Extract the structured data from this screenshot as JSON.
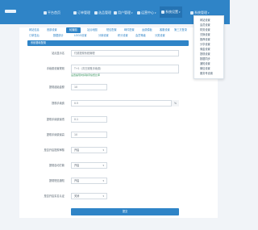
{
  "nav": {
    "items": [
      {
        "label": "平台首页"
      },
      {
        "label": "订单管理"
      },
      {
        "label": "选品管理"
      },
      {
        "label": "用户管理"
      },
      {
        "label": "运营中心"
      },
      {
        "label": "系统设置"
      },
      {
        "label": "系统管理"
      }
    ]
  },
  "dropdown": {
    "items": [
      "网站设置",
      "会员设置",
      "财务设置",
      "兑换设置",
      "推荐设置",
      "分享设置",
      "佣金设置",
      "提现设置",
      "数据同步",
      "通知设置",
      "微信设置",
      "服务号设置"
    ]
  },
  "tabs": {
    "row1": [
      "网站信息",
      "底部设置",
      "轮播图",
      "站点地图",
      "短信配置",
      "邮件配置",
      "运费模板",
      "客服设置",
      "第三方登录",
      "帮助中心"
    ],
    "row2": [
      "订单售后",
      "数据统计",
      "LOGO设置",
      "分销设置",
      "积分设置",
      "会员等级",
      "分类设置"
    ]
  },
  "section": {
    "title": "系统基础配置"
  },
  "form": {
    "site_name": {
      "label": "站点显示名",
      "value": "付费提现系统管理"
    },
    "fee_rate": {
      "label": "手续费设置规则",
      "value": "T+1（次日到账手续费）",
      "hint": "设置提现时扣除手续费比率"
    },
    "min_amount": {
      "label": "提现起始金额",
      "value": "10"
    },
    "rate": {
      "label": "提现手续费",
      "value": "0.5",
      "suffix": "%"
    },
    "min_fee": {
      "label": "提现手续费最低",
      "value": "0.1"
    },
    "max_fee": {
      "label": "提现手续费最高",
      "value": "10"
    },
    "switch1": {
      "label": "是否开启提现审核",
      "value": "开启"
    },
    "switch2": {
      "label": "提现自动打款",
      "value": "开启"
    },
    "switch3": {
      "label": "提现短信通知",
      "value": "开启"
    },
    "switch4": {
      "label": "是否开启实名认证",
      "value": "关闭"
    },
    "switch5": {
      "label": "银行卡信息审核",
      "value": "关闭"
    }
  },
  "submit": {
    "label": "提交"
  }
}
